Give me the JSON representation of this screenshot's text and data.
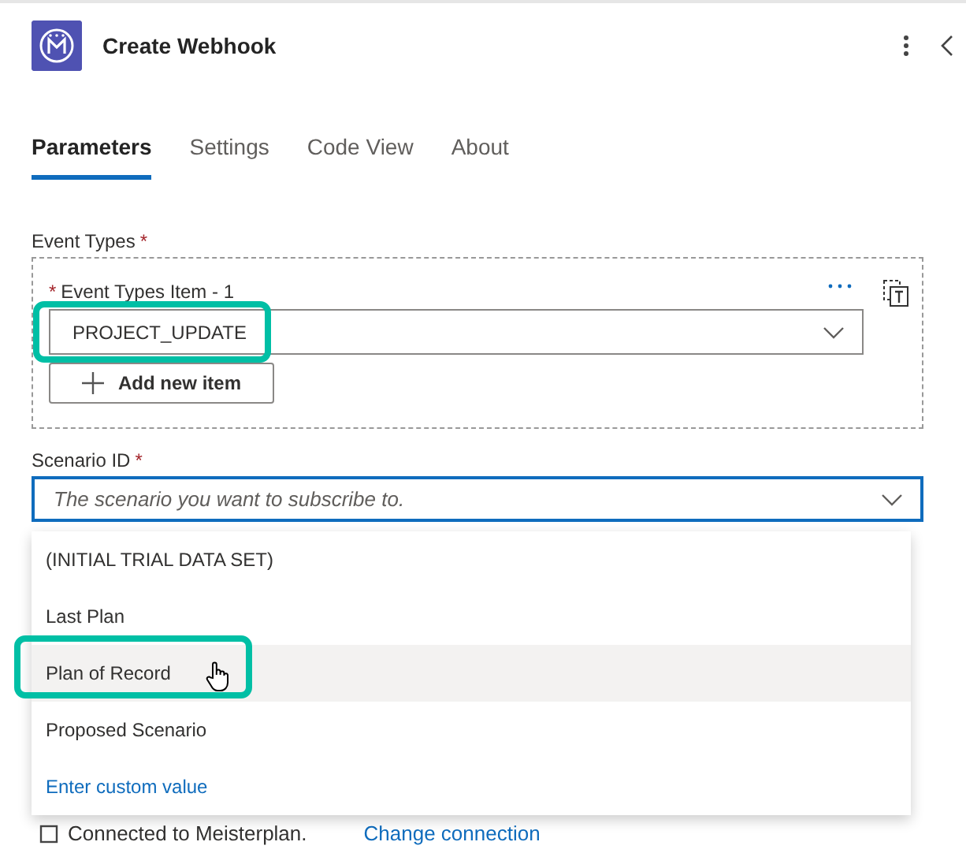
{
  "header": {
    "title": "Create Webhook"
  },
  "tabs": [
    {
      "label": "Parameters",
      "selected": true
    },
    {
      "label": "Settings",
      "selected": false
    },
    {
      "label": "Code View",
      "selected": false
    },
    {
      "label": "About",
      "selected": false
    }
  ],
  "event_types": {
    "label": "Event Types",
    "required_mark": "*",
    "add_button": "Add new item",
    "items": [
      {
        "label": "Event Types Item - 1",
        "required_mark": "*",
        "value": "PROJECT_UPDATE",
        "highlighted": true
      }
    ]
  },
  "scenario_id": {
    "label": "Scenario ID",
    "required_mark": "*",
    "placeholder": "The scenario you want to subscribe to.",
    "focused": true,
    "options": [
      {
        "label": "(INITIAL TRIAL DATA SET)",
        "selected": false,
        "highlighted": false
      },
      {
        "label": "Last Plan",
        "selected": false,
        "highlighted": false
      },
      {
        "label": "Plan of Record",
        "selected": true,
        "highlighted": true
      },
      {
        "label": "Proposed Scenario",
        "selected": false,
        "highlighted": false
      }
    ],
    "custom_value": "Enter custom value"
  },
  "connection": {
    "text": "Connected to Meisterplan.",
    "link": "Change connection"
  }
}
